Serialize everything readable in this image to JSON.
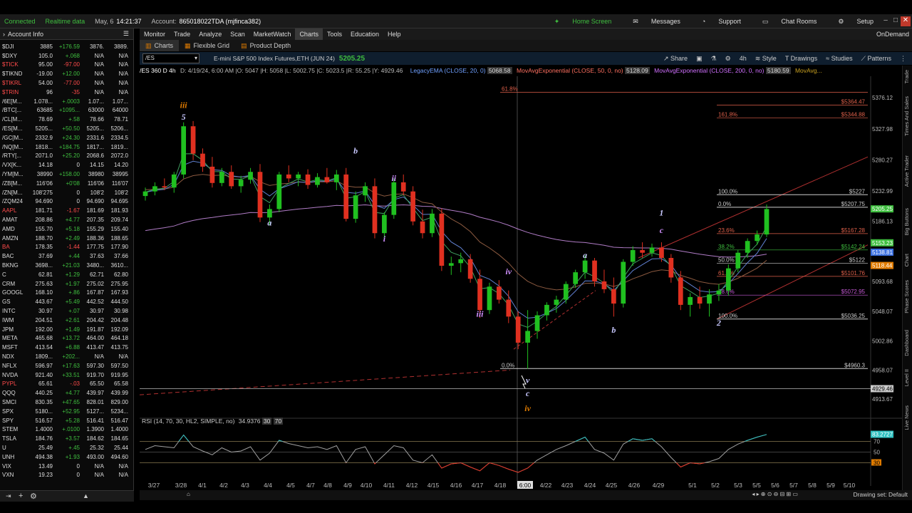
{
  "status": {
    "connected": "Connected",
    "realtime": "Realtime data",
    "date": "May, 6",
    "time": "14:21:37",
    "account_label": "Account:",
    "account": "865018022TDA (mjfinca382)"
  },
  "topnav": {
    "home": "Home Screen",
    "messages": "Messages",
    "support": "Support",
    "chat": "Chat Rooms",
    "setup": "Setup"
  },
  "left": {
    "title": "Account Info"
  },
  "watchlist": [
    {
      "sym": "$DJI",
      "c2": "3885",
      "c3": "+176.59",
      "c4": "3876.",
      "c5": "3889.",
      "dir": "pos"
    },
    {
      "sym": "$DXY",
      "c2": "105.0",
      "c3": "+.068",
      "c4": "N/A",
      "c5": "N/A",
      "dir": "pos"
    },
    {
      "sym": "$TICK",
      "c2": "95.00",
      "c3": "-97.00",
      "c4": "N/A",
      "c5": "N/A",
      "dir": "neg"
    },
    {
      "sym": "$TIKND",
      "c2": "-19.00",
      "c3": "+12.00",
      "c4": "N/A",
      "c5": "N/A",
      "dir": "pos"
    },
    {
      "sym": "$TIKRL",
      "c2": "54.00",
      "c3": "-77.00",
      "c4": "N/A",
      "c5": "N/A",
      "dir": "neg"
    },
    {
      "sym": "$TRIN",
      "c2": "96",
      "c3": "-35",
      "c4": "N/A",
      "c5": "N/A",
      "dir": "neg"
    },
    {
      "sym": "/6E[M...",
      "c2": "1.078...",
      "c3": "+.0003",
      "c4": "1.07...",
      "c5": "1.07...",
      "dir": "pos"
    },
    {
      "sym": "/BTC[...",
      "c2": "63685",
      "c3": "+1095...",
      "c4": "63000",
      "c5": "64000",
      "dir": "pos"
    },
    {
      "sym": "/CL[M...",
      "c2": "78.69",
      "c3": "+.58",
      "c4": "78.66",
      "c5": "78.71",
      "dir": "pos"
    },
    {
      "sym": "/ES[M...",
      "c2": "5205...",
      "c3": "+50.50",
      "c4": "5205...",
      "c5": "5206...",
      "dir": "pos"
    },
    {
      "sym": "/GC[M...",
      "c2": "2332.9",
      "c3": "+24.30",
      "c4": "2331.6",
      "c5": "2334.5",
      "dir": "pos"
    },
    {
      "sym": "/NQ[M...",
      "c2": "1818...",
      "c3": "+184.75",
      "c4": "1817...",
      "c5": "1819...",
      "dir": "pos"
    },
    {
      "sym": "/RTY[...",
      "c2": "2071.0",
      "c3": "+25.20",
      "c4": "2068.6",
      "c5": "2072.0",
      "dir": "pos"
    },
    {
      "sym": "/VX[K...",
      "c2": "14.18",
      "c3": "0",
      "c4": "14.15",
      "c5": "14.20",
      "dir": "wht"
    },
    {
      "sym": "/YM[M...",
      "c2": "38990",
      "c3": "+158.00",
      "c4": "38980",
      "c5": "38995",
      "dir": "pos"
    },
    {
      "sym": "/ZB[M...",
      "c2": "116'06",
      "c3": "+0'08",
      "c4": "116'06",
      "c5": "116'07",
      "dir": "pos"
    },
    {
      "sym": "/ZN[M...",
      "c2": "108'275",
      "c3": "0",
      "c4": "108'2",
      "c5": "108'2",
      "dir": "wht"
    },
    {
      "sym": "/ZQM24",
      "c2": "94.690",
      "c3": "0",
      "c4": "94.690",
      "c5": "94.695",
      "dir": "wht"
    },
    {
      "sym": "AAPL",
      "c2": "181.71",
      "c3": "-1.67",
      "c4": "181.69",
      "c5": "181.93",
      "dir": "neg"
    },
    {
      "sym": "AMAT",
      "c2": "208.86",
      "c3": "+4.77",
      "c4": "207.35",
      "c5": "209.74",
      "dir": "pos"
    },
    {
      "sym": "AMD",
      "c2": "155.70",
      "c3": "+5.18",
      "c4": "155.29",
      "c5": "155.40",
      "dir": "pos"
    },
    {
      "sym": "AMZN",
      "c2": "188.70",
      "c3": "+2.49",
      "c4": "188.36",
      "c5": "188.65",
      "dir": "pos"
    },
    {
      "sym": "BA",
      "c2": "178.35",
      "c3": "-1.44",
      "c4": "177.75",
      "c5": "177.90",
      "dir": "neg"
    },
    {
      "sym": "BAC",
      "c2": "37.69",
      "c3": "+.44",
      "c4": "37.63",
      "c5": "37.66",
      "dir": "pos"
    },
    {
      "sym": "BKNG",
      "c2": "3698...",
      "c3": "+21.03",
      "c4": "3480...",
      "c5": "3610...",
      "dir": "pos"
    },
    {
      "sym": "C",
      "c2": "62.81",
      "c3": "+1.29",
      "c4": "62.71",
      "c5": "62.80",
      "dir": "pos"
    },
    {
      "sym": "CRM",
      "c2": "275.63",
      "c3": "+1.97",
      "c4": "275.02",
      "c5": "275.95",
      "dir": "pos"
    },
    {
      "sym": "GOOGL",
      "c2": "168.10",
      "c3": "+.86",
      "c4": "167.87",
      "c5": "167.93",
      "dir": "pos"
    },
    {
      "sym": "GS",
      "c2": "443.67",
      "c3": "+5.49",
      "c4": "442.52",
      "c5": "444.50",
      "dir": "pos"
    },
    {
      "sym": "INTC",
      "c2": "30.97",
      "c3": "+.07",
      "c4": "30.97",
      "c5": "30.98",
      "dir": "pos"
    },
    {
      "sym": "IWM",
      "c2": "204.51",
      "c3": "+2.61",
      "c4": "204.42",
      "c5": "204.48",
      "dir": "pos"
    },
    {
      "sym": "JPM",
      "c2": "192.00",
      "c3": "+1.49",
      "c4": "191.87",
      "c5": "192.09",
      "dir": "pos"
    },
    {
      "sym": "META",
      "c2": "465.68",
      "c3": "+13.72",
      "c4": "464.00",
      "c5": "464.18",
      "dir": "pos"
    },
    {
      "sym": "MSFT",
      "c2": "413.54",
      "c3": "+6.88",
      "c4": "413.47",
      "c5": "413.75",
      "dir": "pos"
    },
    {
      "sym": "NDX",
      "c2": "1809...",
      "c3": "+202...",
      "c4": "N/A",
      "c5": "N/A",
      "dir": "pos"
    },
    {
      "sym": "NFLX",
      "c2": "596.97",
      "c3": "+17.63",
      "c4": "597.30",
      "c5": "597.50",
      "dir": "pos"
    },
    {
      "sym": "NVDA",
      "c2": "921.40",
      "c3": "+33.51",
      "c4": "919.70",
      "c5": "919.95",
      "dir": "pos"
    },
    {
      "sym": "PYPL",
      "c2": "65.61",
      "c3": "-.03",
      "c4": "65.50",
      "c5": "65.58",
      "dir": "neg"
    },
    {
      "sym": "QQQ",
      "c2": "440.25",
      "c3": "+4.77",
      "c4": "439.97",
      "c5": "439.99",
      "dir": "pos"
    },
    {
      "sym": "SMCI",
      "c2": "830.35",
      "c3": "+47.65",
      "c4": "828.01",
      "c5": "829.00",
      "dir": "pos"
    },
    {
      "sym": "SPX",
      "c2": "5180...",
      "c3": "+52.95",
      "c4": "5127...",
      "c5": "5234...",
      "dir": "pos"
    },
    {
      "sym": "SPY",
      "c2": "516.57",
      "c3": "+5.28",
      "c4": "516.41",
      "c5": "516.47",
      "dir": "pos"
    },
    {
      "sym": "STEM",
      "c2": "1.4000",
      "c3": "+.0100",
      "c4": "1.3900",
      "c5": "1.4000",
      "dir": "pos"
    },
    {
      "sym": "TSLA",
      "c2": "184.76",
      "c3": "+3.57",
      "c4": "184.62",
      "c5": "184.65",
      "dir": "pos"
    },
    {
      "sym": "U",
      "c2": "25.49",
      "c3": "+.45",
      "c4": "25.32",
      "c5": "25.44",
      "dir": "pos"
    },
    {
      "sym": "UNH",
      "c2": "494.38",
      "c3": "+1.93",
      "c4": "493.00",
      "c5": "494.60",
      "dir": "pos"
    },
    {
      "sym": "VIX",
      "c2": "13.49",
      "c3": "0",
      "c4": "N/A",
      "c5": "N/A",
      "dir": "wht"
    },
    {
      "sym": "VXN",
      "c2": "19.23",
      "c3": "0",
      "c4": "N/A",
      "c5": "N/A",
      "dir": "wht"
    }
  ],
  "menu": [
    "Monitor",
    "Trade",
    "Analyze",
    "Scan",
    "MarketWatch",
    "Charts",
    "Tools",
    "Education",
    "Help"
  ],
  "ondemand": "OnDemand",
  "subtabs": [
    "Charts",
    "Flexible Grid",
    "Product Depth"
  ],
  "charttool": {
    "symbol": "/ES",
    "desc": "E-mini S&P 500 Index Futures,ETH (JUN 24)",
    "price": "5205.25",
    "share": "Share",
    "interval": "4h",
    "style": "Style",
    "drawings": "Drawings",
    "studies": "Studies",
    "patterns": "Patterns"
  },
  "studyline": {
    "head": "/ES 360 D 4h",
    "ohlc": "D: 4/19/24, 6:00 AM  |O: 5047  |H: 5058  |L: 5002.75  |C: 5023.5  |R: 55.25  |Y: 4929.46",
    "s1": "LegacyEMA (CLOSE, 20, 0)",
    "v1": "5068.58",
    "s2": "MovAvgExponential (CLOSE, 50, 0, no)",
    "v2": "5128.09",
    "s3": "MovAvgExponential (CLOSE, 200, 0, no)",
    "v3": "5180.59",
    "s4": "MovAvg..."
  },
  "chart_data": {
    "type": "candlestick",
    "x_tick_labels": [
      "3/27",
      "3/28",
      "4/1",
      "4/2",
      "4/3",
      "4/4",
      "4/5",
      "4/7",
      "4/8",
      "4/9",
      "4/10",
      "4/11",
      "4/12",
      "4/15",
      "4/16",
      "4/17",
      "4/18",
      "6:00",
      "4/22",
      "4/23",
      "4/24",
      "4/25",
      "4/26",
      "4/29",
      "5/1",
      "5/2",
      "5/3",
      "5/5",
      "5/6",
      "5/7",
      "5/8",
      "5/9",
      "5/10"
    ],
    "y_tick_labels": [
      "5376.12",
      "5327.98",
      "5280.27",
      "5232.99",
      "5186.13",
      "5139.71",
      "5093.68",
      "5048.07",
      "5002.86",
      "4958.07",
      "4913.67"
    ],
    "ylim": [
      4895,
      5400
    ],
    "price_marks": [
      {
        "label": "5205.25",
        "value": 5205.25,
        "color": "#3fbf3f"
      },
      {
        "label": "5153.23",
        "value": 5153.23,
        "color": "#3fbf3f"
      },
      {
        "label": "5138.81",
        "value": 5138.81,
        "color": "#3a6fe0"
      },
      {
        "label": "5118.44",
        "value": 5118.44,
        "color": "#e07b00"
      },
      {
        "label": "4929.46",
        "value": 4929.46,
        "color": "#cccccc"
      }
    ],
    "fib_levels": [
      {
        "label": "61.8%",
        "value": 5384,
        "price": "",
        "color": "#e0604a"
      },
      {
        "label": "",
        "value": 5364.47,
        "price": "$5364.47",
        "color": "#e0604a"
      },
      {
        "label": "161.8%",
        "value": 5344.88,
        "price": "$5344.88",
        "color": "#e0604a"
      },
      {
        "label": "100.0%",
        "value": 5227,
        "price": "$5227",
        "color": "#cccccc"
      },
      {
        "label": "0.0%",
        "value": 5207.75,
        "price": "$5207.75",
        "color": "#cccccc"
      },
      {
        "label": "23.6%",
        "value": 5167.28,
        "price": "$5167.28",
        "color": "#e0604a"
      },
      {
        "label": "38.2%",
        "value": 5142.24,
        "price": "$5142.24",
        "color": "#3fbf3f"
      },
      {
        "label": "50.0%",
        "value": 5122,
        "price": "$5122",
        "color": "#cccccc"
      },
      {
        "label": "61.8%",
        "value": 5101.76,
        "price": "$5101.76",
        "color": "#e0604a"
      },
      {
        "label": "78.6%",
        "value": 5072.95,
        "price": "$5072.95",
        "color": "#c85ad8"
      },
      {
        "label": "100.0%",
        "value": 5036.25,
        "price": "$5036.25",
        "color": "#cccccc"
      },
      {
        "label": "0.0%",
        "value": 4960.3,
        "price": "$4960.3",
        "color": "#cccccc"
      }
    ],
    "wave_labels": [
      {
        "t": "iii",
        "i": 4,
        "v": 5360,
        "c": "#e07b00"
      },
      {
        "t": "5",
        "i": 4,
        "v": 5342,
        "c": "#c8c8ff"
      },
      {
        "t": "a",
        "i": 13,
        "v": 5180,
        "c": "#c8c8ff"
      },
      {
        "t": "b",
        "i": 22,
        "v": 5290,
        "c": "#c8c8ff"
      },
      {
        "t": "ii",
        "i": 26,
        "v": 5248,
        "c": "#d090ff"
      },
      {
        "t": "i",
        "i": 25,
        "v": 5155,
        "c": "#d090ff"
      },
      {
        "t": "iv",
        "i": 38,
        "v": 5105,
        "c": "#d090ff"
      },
      {
        "t": "iii",
        "i": 35,
        "v": 5040,
        "c": "#d090ff"
      },
      {
        "t": "v",
        "i": 40,
        "v": 4938,
        "c": "#c8c8ff"
      },
      {
        "t": "c",
        "i": 40,
        "v": 4918,
        "c": "#c8c8ff"
      },
      {
        "t": "iv",
        "i": 40,
        "v": 4895,
        "c": "#e07b00"
      },
      {
        "t": "a",
        "i": 46,
        "v": 5130,
        "c": "#c8c8ff"
      },
      {
        "t": "b",
        "i": 49,
        "v": 5015,
        "c": "#c8c8ff"
      },
      {
        "t": "1",
        "i": 54,
        "v": 5195,
        "c": "#c8c8ff"
      },
      {
        "t": "c",
        "i": 54,
        "v": 5168,
        "c": "#d090ff"
      },
      {
        "t": "2",
        "i": 60,
        "v": 5026,
        "c": "#c8c8ff"
      }
    ],
    "candles": [
      [
        5225,
        5238,
        5218,
        5232
      ],
      [
        5232,
        5246,
        5226,
        5240
      ],
      [
        5240,
        5252,
        5234,
        5238
      ],
      [
        5238,
        5262,
        5230,
        5258
      ],
      [
        5258,
        5338,
        5252,
        5332
      ],
      [
        5332,
        5340,
        5280,
        5290
      ],
      [
        5290,
        5298,
        5262,
        5270
      ],
      [
        5270,
        5285,
        5238,
        5245
      ],
      [
        5245,
        5268,
        5240,
        5262
      ],
      [
        5262,
        5272,
        5236,
        5240
      ],
      [
        5240,
        5256,
        5230,
        5250
      ],
      [
        5250,
        5268,
        5244,
        5262
      ],
      [
        5262,
        5274,
        5185,
        5192
      ],
      [
        5192,
        5212,
        5180,
        5205
      ],
      [
        5205,
        5262,
        5200,
        5258
      ],
      [
        5258,
        5272,
        5246,
        5252
      ],
      [
        5252,
        5262,
        5240,
        5258
      ],
      [
        5258,
        5266,
        5236,
        5242
      ],
      [
        5242,
        5260,
        5238,
        5254
      ],
      [
        5254,
        5268,
        5244,
        5246
      ],
      [
        5246,
        5265,
        5234,
        5258
      ],
      [
        5258,
        5268,
        5186,
        5190
      ],
      [
        5190,
        5232,
        5184,
        5226
      ],
      [
        5226,
        5246,
        5216,
        5240
      ],
      [
        5240,
        5252,
        5160,
        5168
      ],
      [
        5168,
        5200,
        5160,
        5196
      ],
      [
        5196,
        5252,
        5190,
        5246
      ],
      [
        5246,
        5258,
        5226,
        5232
      ],
      [
        5232,
        5240,
        5180,
        5186
      ],
      [
        5186,
        5204,
        5160,
        5168
      ],
      [
        5168,
        5205,
        5162,
        5198
      ],
      [
        5198,
        5206,
        5110,
        5118
      ],
      [
        5118,
        5132,
        5104,
        5122
      ],
      [
        5122,
        5138,
        5108,
        5128
      ],
      [
        5128,
        5136,
        5092,
        5098
      ],
      [
        5098,
        5112,
        5038,
        5050
      ],
      [
        5050,
        5092,
        5044,
        5086
      ],
      [
        5086,
        5096,
        5060,
        5066
      ],
      [
        5066,
        5080,
        5030,
        5040
      ],
      [
        5040,
        5048,
        4990,
        5000
      ],
      [
        5000,
        5050,
        4960,
        5018
      ],
      [
        5018,
        5048,
        5006,
        5042
      ],
      [
        5042,
        5062,
        5034,
        5058
      ],
      [
        5058,
        5072,
        5046,
        5066
      ],
      [
        5066,
        5094,
        5060,
        5090
      ],
      [
        5090,
        5112,
        5084,
        5108
      ],
      [
        5108,
        5134,
        5098,
        5126
      ],
      [
        5126,
        5130,
        5086,
        5094
      ],
      [
        5094,
        5112,
        5076,
        5082
      ],
      [
        5082,
        5100,
        5040,
        5060
      ],
      [
        5060,
        5128,
        5054,
        5124
      ],
      [
        5124,
        5148,
        5118,
        5142
      ],
      [
        5142,
        5154,
        5130,
        5138
      ],
      [
        5138,
        5152,
        5132,
        5146
      ],
      [
        5146,
        5154,
        5124,
        5130
      ],
      [
        5130,
        5136,
        5092,
        5100
      ],
      [
        5100,
        5110,
        5050,
        5058
      ],
      [
        5058,
        5076,
        5040,
        5070
      ],
      [
        5070,
        5086,
        5052,
        5060
      ],
      [
        5060,
        5082,
        5040,
        5074
      ],
      [
        5074,
        5090,
        5064,
        5080
      ],
      [
        5080,
        5120,
        5072,
        5114
      ],
      [
        5114,
        5142,
        5108,
        5138
      ],
      [
        5138,
        5160,
        5130,
        5156
      ],
      [
        5156,
        5172,
        5150,
        5166
      ],
      [
        5166,
        5212,
        5162,
        5205
      ]
    ],
    "rsi": {
      "label": "RSI (14, 70, 30, HL2, SIMPLE, no)",
      "value": "34.9376",
      "levels": [
        "30",
        "70"
      ],
      "ylim": [
        0,
        100
      ],
      "current": "83.2727",
      "level_labels": [
        "70",
        "50",
        "30"
      ],
      "values": [
        55,
        62,
        60,
        58,
        82,
        60,
        52,
        45,
        58,
        50,
        52,
        60,
        35,
        48,
        72,
        66,
        62,
        58,
        60,
        55,
        62,
        30,
        55,
        60,
        28,
        45,
        62,
        58,
        35,
        30,
        45,
        20,
        28,
        30,
        22,
        15,
        30,
        25,
        18,
        12,
        20,
        35,
        45,
        55,
        62,
        70,
        78,
        55,
        48,
        35,
        65,
        75,
        72,
        75,
        60,
        40,
        22,
        30,
        28,
        32,
        38,
        55,
        65,
        72,
        78,
        83
      ]
    }
  },
  "bottom": {
    "drawing_set": "Drawing set: Default"
  },
  "rightside": [
    "Trade",
    "Times And Sales",
    "Active Trader",
    "Big Buttons",
    "Chart",
    "Phase Scores",
    "Dashboard",
    "Level II",
    "Live News"
  ]
}
